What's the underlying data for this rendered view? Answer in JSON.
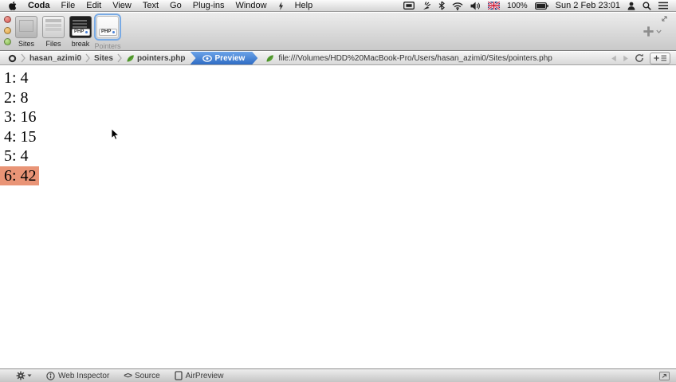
{
  "menu_bar": {
    "items": [
      "Coda",
      "File",
      "Edit",
      "View",
      "Text",
      "Go",
      "Plug-ins",
      "Window",
      "Help"
    ],
    "battery_percent": "100%",
    "clock": "Sun 2 Feb 23:01"
  },
  "toolbar": {
    "items": [
      {
        "label": "Sites"
      },
      {
        "label": "Files"
      },
      {
        "label": "break",
        "badge": "PHP"
      },
      {
        "label": "Pointers",
        "badge": "PHP",
        "selected": true
      }
    ]
  },
  "path_bar": {
    "crumbs": [
      "hasan_azimi0",
      "Sites",
      "pointers.php"
    ],
    "preview_tab": "Preview",
    "url": "file:///Volumes/HDD%20MacBook-Pro/Users/hasan_azimi0/Sites/pointers.php"
  },
  "content": {
    "lines": [
      {
        "text": "1: 4",
        "highlight": false
      },
      {
        "text": "2: 8",
        "highlight": false
      },
      {
        "text": "3: 16",
        "highlight": false
      },
      {
        "text": "4: 15",
        "highlight": false
      },
      {
        "text": "5: 4",
        "highlight": false
      },
      {
        "text": "6: 42",
        "highlight": true
      }
    ]
  },
  "status_bar": {
    "web_inspector": "Web Inspector",
    "source": "Source",
    "airpreview": "AirPreview",
    "icons": {
      "source_glyph": "<>"
    }
  },
  "colors": {
    "highlight": "#e99476",
    "tab_blue_top": "#6ba3e8",
    "tab_blue_bottom": "#2f6cc4"
  }
}
